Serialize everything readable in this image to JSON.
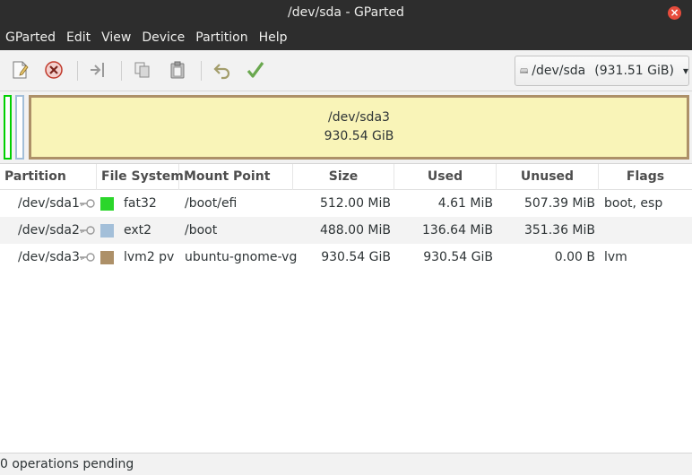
{
  "window": {
    "title": "/dev/sda - GParted"
  },
  "menu": [
    "GParted",
    "Edit",
    "View",
    "Device",
    "Partition",
    "Help"
  ],
  "toolbar": {
    "buttons": [
      "new-icon",
      "delete-icon",
      "resize-move-icon",
      "copy-icon",
      "paste-icon",
      "undo-icon",
      "apply-icon"
    ],
    "device": {
      "name": "/dev/sda",
      "size": "(931.51 GiB)"
    }
  },
  "graphic": {
    "selected": {
      "name": "/dev/sda3",
      "size": "930.54 GiB"
    }
  },
  "table": {
    "headers": [
      "Partition",
      "File System",
      "Mount Point",
      "Size",
      "Used",
      "Unused",
      "Flags"
    ],
    "rows": [
      {
        "partition": "/dev/sda1",
        "filesystem": "fat32",
        "fs_color": "#2bd62b",
        "mount": "/boot/efi",
        "size": "512.00 MiB",
        "used": "4.61 MiB",
        "unused": "507.39 MiB",
        "flags": "boot, esp"
      },
      {
        "partition": "/dev/sda2",
        "filesystem": "ext2",
        "fs_color": "#a3bfd9",
        "mount": "/boot",
        "size": "488.00 MiB",
        "used": "136.64 MiB",
        "unused": "351.36 MiB",
        "flags": ""
      },
      {
        "partition": "/dev/sda3",
        "filesystem": "lvm2 pv",
        "fs_color": "#ad9068",
        "mount": "ubuntu-gnome-vg",
        "size": "930.54 GiB",
        "used": "930.54 GiB",
        "unused": "0.00 B",
        "flags": "lvm"
      }
    ]
  },
  "status": {
    "text": "0 operations pending"
  },
  "colors": {
    "titlebar": "#2d2d2d",
    "close": "#e74c3c",
    "selected_partition_fill": "#f9f4b8"
  }
}
